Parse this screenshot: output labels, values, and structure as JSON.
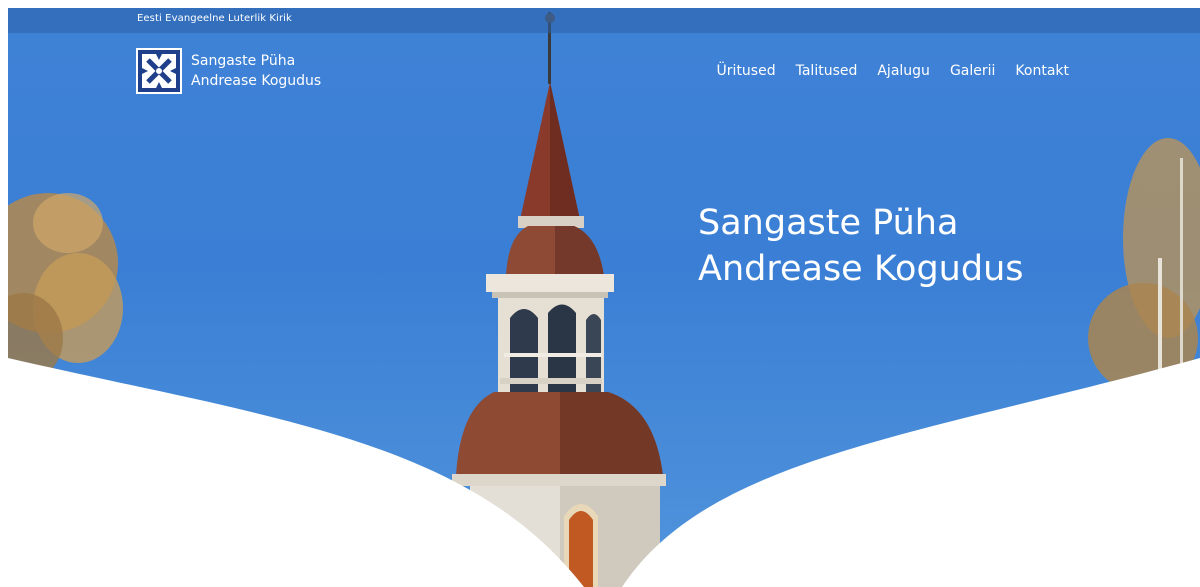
{
  "topbar": {
    "text": "Eesti Evangeelne Luterlik Kirik"
  },
  "logo": {
    "icon": "andrew-cross-logo-icon",
    "line1": "Sangaste Püha",
    "line2": "Andrease Kogudus"
  },
  "nav": {
    "items": [
      {
        "label": "Üritused"
      },
      {
        "label": "Talitused"
      },
      {
        "label": "Ajalugu"
      },
      {
        "label": "Galerii"
      },
      {
        "label": "Kontakt"
      }
    ]
  },
  "hero": {
    "title_line1": "Sangaste Püha",
    "title_line2": "Andrease Kogudus"
  },
  "colors": {
    "sky": "#3f82d6",
    "topbar": "#2c60aa",
    "logo_bg": "#1f3f8a",
    "roof": "#8a3a2a"
  }
}
